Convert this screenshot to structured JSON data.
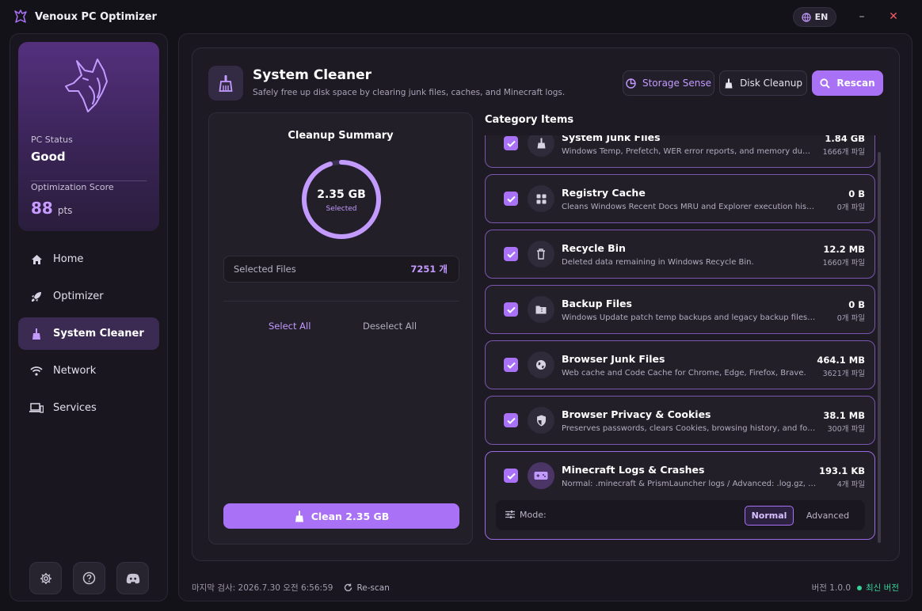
{
  "app": {
    "title": "Venoux PC Optimizer",
    "language": "EN"
  },
  "window_controls": {
    "minimize": "–",
    "close": "✕"
  },
  "sidebar": {
    "status_label": "PC Status",
    "status_value": "Good",
    "score_label": "Optimization Score",
    "score_value": "88",
    "score_unit": "pts",
    "items": [
      {
        "label": "Home",
        "icon": "home-icon"
      },
      {
        "label": "Optimizer",
        "icon": "rocket-icon"
      },
      {
        "label": "System Cleaner",
        "icon": "broom-icon",
        "active": true
      },
      {
        "label": "Network",
        "icon": "wifi-icon"
      },
      {
        "label": "Services",
        "icon": "devices-icon"
      }
    ],
    "footer_icons": [
      "settings-icon",
      "help-icon",
      "discord-icon"
    ]
  },
  "header": {
    "title": "System Cleaner",
    "subtitle": "Safely free up disk space by clearing junk files, caches, and Minecraft logs.",
    "storage_sense_label": "Storage Sense",
    "disk_cleanup_label": "Disk Cleanup",
    "rescan_label": "Rescan"
  },
  "summary": {
    "title": "Cleanup Summary",
    "ring_value": "2.35 GB",
    "ring_label": "Selected",
    "ring_fraction": 0.95,
    "selected_files_label": "Selected Files",
    "selected_files_value": "7251 개",
    "select_all_label": "Select All",
    "deselect_all_label": "Deselect All",
    "clean_label": "Clean 2.35 GB"
  },
  "categories": {
    "title": "Category Items",
    "items": [
      {
        "name": "System Junk Files",
        "desc": "Windows Temp, Prefetch, WER error reports, and memory dump...",
        "size": "1.84 GB",
        "count": "1666개 파일",
        "icon": "broom-icon",
        "checked": true
      },
      {
        "name": "Registry Cache",
        "desc": "Cleans Windows Recent Docs MRU and Explorer execution history ...",
        "size": "0 B",
        "count": "0개 파일",
        "icon": "grid-icon",
        "checked": true
      },
      {
        "name": "Recycle Bin",
        "desc": "Deleted data remaining in Windows Recycle Bin.",
        "size": "12.2 MB",
        "count": "1660개 파일",
        "icon": "trash-icon",
        "checked": true
      },
      {
        "name": "Backup Files",
        "desc": "Windows Update patch temp backups and legacy backup files (*.ba...",
        "size": "0 B",
        "count": "0개 파일",
        "icon": "archive-icon",
        "checked": true
      },
      {
        "name": "Browser Junk Files",
        "desc": "Web cache and Code Cache for Chrome, Edge, Firefox, Brave.",
        "size": "464.1 MB",
        "count": "3621개 파일",
        "icon": "globe-icon",
        "checked": true
      },
      {
        "name": "Browser Privacy & Cookies",
        "desc": "Preserves passwords, clears Cookies, browsing history, and form ...",
        "size": "38.1 MB",
        "count": "300개 파일",
        "icon": "shield-icon",
        "checked": true
      },
      {
        "name": "Minecraft Logs & Crashes",
        "desc": "Normal: .minecraft & PrismLauncher logs / Advanced: .log.gz, .js...",
        "size": "193.1 KB",
        "count": "4개 파일",
        "icon": "gamepad-icon",
        "checked": true
      }
    ],
    "mode_label": "Mode:",
    "mode_normal": "Normal",
    "mode_advanced": "Advanced",
    "mode_selected": "Normal"
  },
  "footer": {
    "last_scan": "마지막 검사: 2026.7.30 오전 6:56:59",
    "rescan_label": "Re-scan",
    "version": "버전 1.0.0",
    "latest": "최신 버전"
  },
  "colors": {
    "accent": "#A971F6",
    "accent_light": "#C39BFF",
    "success": "#34D399",
    "background": "#141219"
  }
}
